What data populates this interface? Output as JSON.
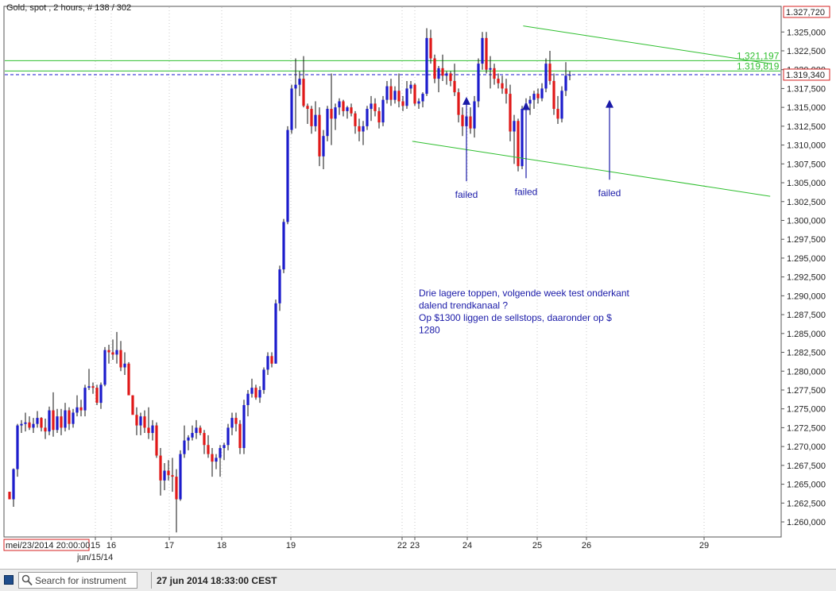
{
  "chart_data": {
    "type": "candlestick",
    "title": "Gold, spot , 2 hours, # 138 / 302",
    "y_axis": {
      "side": "right",
      "range": [
        1258.0,
        1328.4
      ],
      "tick_step": 2.5,
      "tick_labels": [
        "1.325,000",
        "1.322,500",
        "1.320,000",
        "1.317,500",
        "1.315,000",
        "1.312,500",
        "1.310,000",
        "1.307,500",
        "1.305,000",
        "1.302,500",
        "1.300,000",
        "1.297,500",
        "1.295,000",
        "1.292,500",
        "1.290,000",
        "1.287,500",
        "1.285,000",
        "1.282,500",
        "1.280,000",
        "1.277,500",
        "1.275,000",
        "1.272,500",
        "1.270,000",
        "1.267,500",
        "1.265,000",
        "1.262,500",
        "1.260,000"
      ],
      "top_label": "1.327,720",
      "current_price_label": "1.319,340"
    },
    "x_axis": {
      "tick_labels": [
        "15",
        "16",
        "17",
        "18",
        "19",
        "22",
        "23",
        "24",
        "25",
        "26",
        "29"
      ],
      "start_label": "mei/23/2014 20:00:00",
      "month_label": "jun/15/14"
    },
    "grid": "vertical-dotted",
    "current_price": 1319.34,
    "horizontal_levels": [
      {
        "value": 1321.197,
        "label": "1.321,197",
        "color": "#2fbf2f"
      },
      {
        "value": 1319.819,
        "label": "1.319,819",
        "color": "#2fbf2f"
      }
    ],
    "trend_lines": [
      {
        "name": "upper",
        "from": [
          24.8,
          1325.8
        ],
        "to": [
          29.8,
          1320.8
        ],
        "color": "#2fbf2f"
      },
      {
        "name": "lower",
        "from": [
          22.8,
          1310.5
        ],
        "to": [
          29.8,
          1303.2
        ],
        "color": "#2fbf2f"
      }
    ],
    "markers": [
      {
        "label": "failed",
        "bar": 115,
        "arrow_top": 1316.4,
        "arrow_bottom": 1305.2
      },
      {
        "label": "failed",
        "bar": 130,
        "arrow_top": 1315.7,
        "arrow_bottom": 1305.6
      },
      {
        "label": "failed",
        "bar": 151,
        "arrow_top": 1316.0,
        "arrow_bottom": 1305.4
      }
    ],
    "annotation": {
      "lines": [
        "Drie lagere toppen, volgende week test onderkant",
        "dalend trendkanaal ?",
        "Op $1300 liggen de sellstops, daaronder op $",
        "1280"
      ],
      "color": "#1a1aa8"
    },
    "colors": {
      "up": "#1c1ccc",
      "down": "#e01818",
      "wick": "#111111",
      "levels": "#2fbf2f",
      "current": "#1a1acc"
    },
    "series": [
      {
        "name": "Gold, spot",
        "ohlc": [
          [
            1264.0,
            1264.0,
            1263.0,
            1263.0
          ],
          [
            1263.0,
            1267.1,
            1262.0,
            1267.0
          ],
          [
            1267.0,
            1273.0,
            1266.0,
            1272.8
          ],
          [
            1272.8,
            1273.5,
            1271.8,
            1273.0
          ],
          [
            1273.0,
            1274.5,
            1272.0,
            1273.2
          ],
          [
            1273.2,
            1274.0,
            1272.2,
            1272.5
          ],
          [
            1272.5,
            1273.8,
            1271.8,
            1273.0
          ],
          [
            1273.0,
            1274.7,
            1272.5,
            1273.8
          ],
          [
            1273.8,
            1273.9,
            1272.0,
            1272.5
          ],
          [
            1272.5,
            1273.7,
            1271.0,
            1272.0
          ],
          [
            1272.0,
            1275.3,
            1271.5,
            1274.8
          ],
          [
            1274.8,
            1277.2,
            1271.3,
            1272.2
          ],
          [
            1272.2,
            1275.0,
            1271.8,
            1274.0
          ],
          [
            1274.0,
            1275.0,
            1271.5,
            1272.5
          ],
          [
            1272.5,
            1275.8,
            1272.0,
            1274.8
          ],
          [
            1274.8,
            1275.2,
            1272.2,
            1273.0
          ],
          [
            1273.0,
            1275.0,
            1272.5,
            1274.5
          ],
          [
            1274.5,
            1276.8,
            1274.0,
            1275.2
          ],
          [
            1275.2,
            1276.2,
            1274.0,
            1274.8
          ],
          [
            1274.8,
            1278.2,
            1274.0,
            1277.8
          ],
          [
            1277.8,
            1280.3,
            1277.5,
            1278.0
          ],
          [
            1278.0,
            1278.5,
            1277.0,
            1277.8
          ],
          [
            1277.8,
            1278.2,
            1275.5,
            1275.8
          ],
          [
            1275.8,
            1278.5,
            1275.0,
            1278.2
          ],
          [
            1278.2,
            1283.2,
            1278.0,
            1282.8
          ],
          [
            1282.8,
            1283.5,
            1281.0,
            1282.5
          ],
          [
            1282.5,
            1284.2,
            1281.5,
            1282.2
          ],
          [
            1282.2,
            1285.2,
            1281.0,
            1282.8
          ],
          [
            1282.8,
            1284.0,
            1280.0,
            1280.5
          ],
          [
            1280.5,
            1282.5,
            1279.5,
            1281.0
          ],
          [
            1281.0,
            1281.2,
            1277.2,
            1276.8
          ],
          [
            1276.8,
            1276.8,
            1274.5,
            1274.2
          ],
          [
            1274.2,
            1275.2,
            1271.5,
            1272.8
          ],
          [
            1272.8,
            1274.5,
            1271.5,
            1274.0
          ],
          [
            1274.0,
            1274.8,
            1271.8,
            1272.5
          ],
          [
            1272.5,
            1275.2,
            1271.0,
            1271.8
          ],
          [
            1271.8,
            1273.5,
            1270.8,
            1272.8
          ],
          [
            1272.8,
            1273.2,
            1268.5,
            1268.8
          ],
          [
            1268.8,
            1269.8,
            1263.5,
            1265.5
          ],
          [
            1265.5,
            1267.8,
            1264.2,
            1266.8
          ],
          [
            1266.8,
            1268.2,
            1265.5,
            1266.2
          ],
          [
            1266.2,
            1268.5,
            1264.0,
            1266.0
          ],
          [
            1266.0,
            1267.0,
            1258.6,
            1263.0
          ],
          [
            1263.0,
            1269.5,
            1262.8,
            1269.0
          ],
          [
            1269.0,
            1272.8,
            1268.5,
            1270.8
          ],
          [
            1270.8,
            1271.5,
            1269.5,
            1271.2
          ],
          [
            1271.2,
            1272.8,
            1270.8,
            1271.8
          ],
          [
            1271.8,
            1273.5,
            1271.0,
            1272.5
          ],
          [
            1272.5,
            1272.8,
            1271.5,
            1271.8
          ],
          [
            1271.8,
            1272.2,
            1269.0,
            1270.2
          ],
          [
            1270.2,
            1271.5,
            1268.5,
            1269.0
          ],
          [
            1269.0,
            1269.8,
            1266.0,
            1268.0
          ],
          [
            1268.0,
            1269.0,
            1267.0,
            1268.5
          ],
          [
            1268.5,
            1270.2,
            1266.0,
            1269.8
          ],
          [
            1269.8,
            1270.5,
            1268.2,
            1270.2
          ],
          [
            1270.2,
            1273.0,
            1269.5,
            1272.5
          ],
          [
            1272.5,
            1274.5,
            1271.5,
            1273.8
          ],
          [
            1273.8,
            1274.5,
            1272.0,
            1273.0
          ],
          [
            1273.0,
            1273.5,
            1269.0,
            1269.8
          ],
          [
            1269.8,
            1276.2,
            1269.0,
            1275.5
          ],
          [
            1275.5,
            1277.5,
            1274.0,
            1277.0
          ],
          [
            1277.0,
            1279.0,
            1276.5,
            1277.8
          ],
          [
            1277.8,
            1278.2,
            1276.2,
            1276.5
          ],
          [
            1276.5,
            1278.0,
            1275.8,
            1277.5
          ],
          [
            1277.5,
            1280.5,
            1277.0,
            1280.2
          ],
          [
            1280.2,
            1282.5,
            1279.5,
            1282.0
          ],
          [
            1282.0,
            1282.5,
            1280.5,
            1281.0
          ],
          [
            1281.0,
            1289.5,
            1281.0,
            1289.0
          ],
          [
            1289.0,
            1294.0,
            1288.0,
            1293.5
          ],
          [
            1293.5,
            1300.2,
            1293.0,
            1299.8
          ],
          [
            1299.8,
            1312.5,
            1299.5,
            1312.0
          ],
          [
            1312.0,
            1318.0,
            1311.5,
            1317.5
          ],
          [
            1317.5,
            1321.5,
            1312.2,
            1318.0
          ],
          [
            1318.0,
            1319.8,
            1316.5,
            1318.8
          ],
          [
            1318.8,
            1321.8,
            1315.0,
            1315.2
          ],
          [
            1315.2,
            1315.5,
            1312.8,
            1314.8
          ],
          [
            1314.8,
            1315.2,
            1311.5,
            1312.5
          ],
          [
            1312.5,
            1315.8,
            1311.8,
            1314.0
          ],
          [
            1314.0,
            1315.0,
            1307.2,
            1308.5
          ],
          [
            1308.5,
            1312.0,
            1306.8,
            1311.2
          ],
          [
            1311.2,
            1315.2,
            1310.5,
            1314.8
          ],
          [
            1314.8,
            1319.5,
            1310.0,
            1313.5
          ],
          [
            1313.5,
            1315.5,
            1312.0,
            1315.0
          ],
          [
            1315.0,
            1316.2,
            1314.0,
            1315.8
          ],
          [
            1315.8,
            1316.0,
            1313.8,
            1314.5
          ],
          [
            1314.5,
            1315.2,
            1313.5,
            1315.0
          ],
          [
            1315.0,
            1315.5,
            1313.8,
            1314.2
          ],
          [
            1314.2,
            1314.5,
            1311.5,
            1312.5
          ],
          [
            1312.5,
            1313.5,
            1310.5,
            1311.8
          ],
          [
            1311.8,
            1313.2,
            1310.0,
            1312.5
          ],
          [
            1312.5,
            1315.2,
            1312.0,
            1314.8
          ],
          [
            1314.8,
            1316.5,
            1313.2,
            1315.5
          ],
          [
            1315.5,
            1316.2,
            1313.8,
            1314.5
          ],
          [
            1314.5,
            1315.0,
            1312.2,
            1313.0
          ],
          [
            1313.0,
            1316.5,
            1312.5,
            1316.0
          ],
          [
            1316.0,
            1318.5,
            1315.5,
            1317.8
          ],
          [
            1317.8,
            1318.8,
            1315.2,
            1316.0
          ],
          [
            1316.0,
            1317.8,
            1315.5,
            1317.2
          ],
          [
            1317.2,
            1319.5,
            1315.0,
            1315.8
          ],
          [
            1315.8,
            1316.5,
            1314.5,
            1315.2
          ],
          [
            1315.2,
            1318.5,
            1314.8,
            1317.5
          ],
          [
            1317.5,
            1318.5,
            1316.8,
            1318.0
          ],
          [
            1318.0,
            1318.2,
            1315.2,
            1315.5
          ],
          [
            1315.5,
            1316.2,
            1314.8,
            1315.8
          ],
          [
            1315.8,
            1317.0,
            1315.0,
            1316.8
          ],
          [
            1316.8,
            1325.5,
            1316.5,
            1324.2
          ],
          [
            1324.2,
            1325.3,
            1320.8,
            1321.5
          ],
          [
            1321.5,
            1322.0,
            1318.2,
            1318.8
          ],
          [
            1318.8,
            1320.5,
            1317.0,
            1320.2
          ],
          [
            1320.2,
            1322.0,
            1318.5,
            1319.2
          ],
          [
            1319.2,
            1319.8,
            1318.0,
            1319.5
          ],
          [
            1319.5,
            1319.8,
            1317.8,
            1318.5
          ],
          [
            1318.5,
            1320.8,
            1316.5,
            1317.0
          ],
          [
            1317.0,
            1317.5,
            1313.0,
            1314.0
          ],
          [
            1314.0,
            1315.0,
            1311.2,
            1312.5
          ],
          [
            1312.5,
            1316.0,
            1312.0,
            1313.8
          ],
          [
            1313.8,
            1315.0,
            1311.5,
            1312.2
          ],
          [
            1312.2,
            1316.5,
            1311.0,
            1315.8
          ],
          [
            1315.8,
            1321.5,
            1315.0,
            1320.8
          ],
          [
            1320.8,
            1325.0,
            1320.0,
            1324.2
          ],
          [
            1324.2,
            1325.0,
            1319.5,
            1320.0
          ],
          [
            1320.0,
            1321.8,
            1317.5,
            1320.2
          ],
          [
            1320.2,
            1320.8,
            1318.0,
            1318.8
          ],
          [
            1318.8,
            1319.5,
            1317.5,
            1318.2
          ],
          [
            1318.2,
            1319.2,
            1316.8,
            1317.5
          ],
          [
            1317.5,
            1318.8,
            1315.5,
            1316.8
          ],
          [
            1316.8,
            1318.0,
            1310.5,
            1311.8
          ],
          [
            1311.8,
            1314.0,
            1307.5,
            1313.2
          ],
          [
            1313.2,
            1313.5,
            1306.5,
            1307.2
          ],
          [
            1307.2,
            1315.2,
            1306.8,
            1314.8
          ],
          [
            1314.8,
            1316.2,
            1313.5,
            1315.5
          ],
          [
            1315.5,
            1316.5,
            1314.0,
            1316.0
          ],
          [
            1316.0,
            1317.2,
            1314.8,
            1316.8
          ],
          [
            1316.8,
            1317.5,
            1315.5,
            1316.2
          ],
          [
            1316.2,
            1318.2,
            1315.8,
            1317.5
          ],
          [
            1317.5,
            1321.5,
            1317.0,
            1320.8
          ],
          [
            1320.8,
            1322.5,
            1318.0,
            1318.5
          ],
          [
            1318.5,
            1319.5,
            1314.0,
            1314.8
          ],
          [
            1314.8,
            1316.5,
            1312.8,
            1313.5
          ],
          [
            1313.5,
            1317.8,
            1313.0,
            1317.2
          ],
          [
            1317.2,
            1321.0,
            1316.5,
            1319.2
          ],
          [
            1319.2,
            1319.8,
            1318.6,
            1319.34
          ]
        ]
      }
    ]
  },
  "status": {
    "search_placeholder": "Search for instrument",
    "datetime": "27 jun 2014 18:33:00 CEST"
  }
}
